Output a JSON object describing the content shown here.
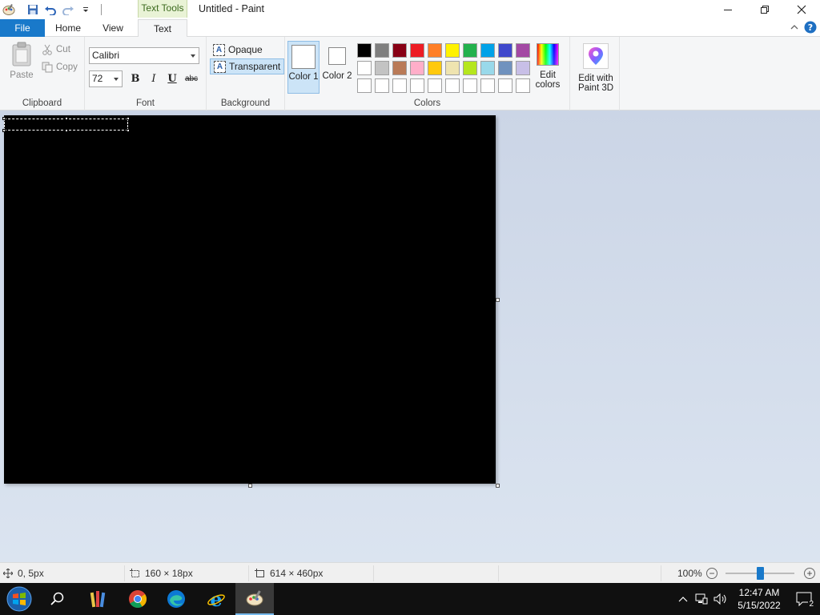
{
  "window": {
    "title": "Untitled - Paint",
    "context_tab_header": "Text Tools"
  },
  "tabs": {
    "file": "File",
    "home": "Home",
    "view": "View",
    "text": "Text"
  },
  "clipboard": {
    "paste": "Paste",
    "cut": "Cut",
    "copy": "Copy",
    "label": "Clipboard"
  },
  "font": {
    "family": "Calibri",
    "size": "72",
    "bold": "B",
    "italic": "I",
    "underline": "U",
    "strikethrough": "abc",
    "label": "Font"
  },
  "background": {
    "opaque": "Opaque",
    "transparent": "Transparent",
    "selected": "transparent",
    "label": "Background"
  },
  "colors": {
    "color1_label": "Color 1",
    "color2_label": "Color 2",
    "color1_value": "#ffffff",
    "color2_value": "#ffffff",
    "edit_colors": "Edit colors",
    "label": "Colors",
    "palette_row1": [
      "#000000",
      "#7f7f7f",
      "#880015",
      "#ed1c24",
      "#ff7f27",
      "#fff200",
      "#22b14c",
      "#00a2e8",
      "#3f48cc",
      "#a349a4"
    ],
    "palette_row2": [
      "#ffffff",
      "#c3c3c3",
      "#b97a57",
      "#ffaec9",
      "#ffc90e",
      "#efe4b0",
      "#b5e61d",
      "#99d9ea",
      "#7092be",
      "#c8bfe7"
    ],
    "palette_row3": [
      "#ffffff",
      "#ffffff",
      "#ffffff",
      "#ffffff",
      "#ffffff",
      "#ffffff",
      "#ffffff",
      "#ffffff",
      "#ffffff",
      "#ffffff"
    ]
  },
  "paint3d": {
    "label": "Edit with Paint 3D"
  },
  "status": {
    "cursor_pos": "0, 5px",
    "selection_size": "160 × 18px",
    "canvas_size": "614 × 460px",
    "zoom": "100%",
    "zoom_fraction": 0.5
  },
  "taskbar": {
    "time": "12:47 AM",
    "date": "5/15/2022",
    "notification_count": "2"
  }
}
